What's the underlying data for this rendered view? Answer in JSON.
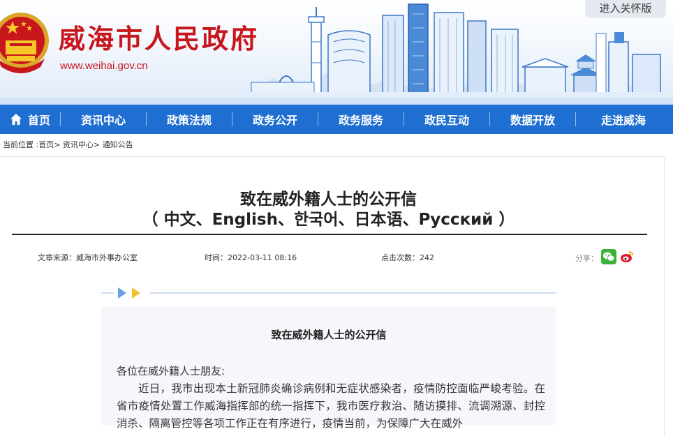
{
  "header": {
    "site_name": "威海市人民政府",
    "site_url": "www.weihai.gov.cn",
    "care_mode_label": "进入关怀版"
  },
  "nav": {
    "items": [
      "首页",
      "资讯中心",
      "政策法规",
      "政务公开",
      "政务服务",
      "政民互动",
      "数据开放",
      "走进威海"
    ]
  },
  "breadcrumb": {
    "prefix": "当前位置 :",
    "items": [
      "首页",
      "资讯中心",
      "通知公告"
    ],
    "separator": ">"
  },
  "article": {
    "title_line1": "致在威外籍人士的公开信",
    "title_line2": "（ 中文、English、한국어、日本语、Русский ）",
    "source_label": "文章来源：",
    "source": "威海市外事办公室",
    "time_label": "时间：",
    "time": "2022-03-11 08:16",
    "views_label": "点击次数：",
    "views": "242",
    "share_label": "分享：",
    "share_icons": [
      "wechat-icon",
      "weibo-icon"
    ]
  },
  "content": {
    "title": "致在威外籍人士的公开信",
    "greeting": "各位在威外籍人士朋友:",
    "paragraph": "近日，我市出现本土新冠肺炎确诊病例和无症状感染者，疫情防控面临严峻考验。在省市疫情处置工作威海指挥部的统一指挥下，我市医疗救治、随访摸排、流调溯源、封控消杀、隔离管控等各项工作正在有序进行，疫情当前，为保障广大在威外"
  },
  "colors": {
    "brand_red": "#c8161d",
    "nav_blue": "#1e6fd1",
    "content_bg": "#f5f7fb"
  }
}
